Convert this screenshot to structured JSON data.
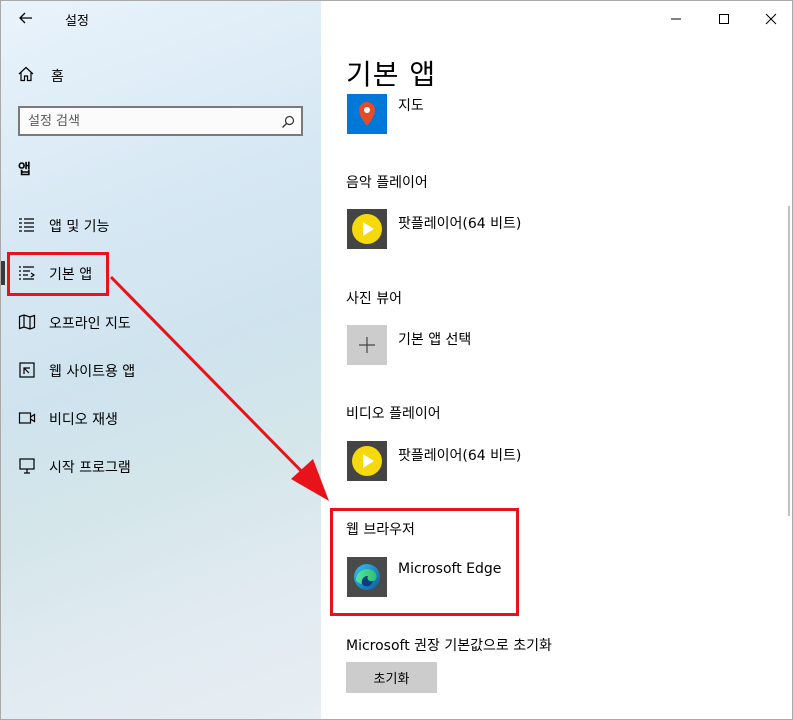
{
  "window": {
    "title": "설정",
    "controls": [
      "minimize-icon",
      "maximize-icon",
      "close-icon"
    ]
  },
  "sidebar": {
    "home_label": "홈",
    "search_placeholder": "설정 검색",
    "section_label": "앱",
    "items": [
      {
        "label": "앱 및 기능",
        "icon": "list-icon",
        "selected": false
      },
      {
        "label": "기본 앱",
        "icon": "default-apps-icon",
        "selected": true
      },
      {
        "label": "오프라인 지도",
        "icon": "map-icon",
        "selected": false
      },
      {
        "label": "웹 사이트용 앱",
        "icon": "website-app-icon",
        "selected": false
      },
      {
        "label": "비디오 재생",
        "icon": "video-icon",
        "selected": false
      },
      {
        "label": "시작 프로그램",
        "icon": "startup-icon",
        "selected": false
      }
    ]
  },
  "main": {
    "title": "기본 앱",
    "map_app_name": "지도",
    "categories": [
      {
        "label": "음악 플레이어",
        "app_name": "팟플레이어(64 비트)",
        "icon": "potplayer-icon"
      },
      {
        "label": "사진 뷰어",
        "app_name": "기본 앱 선택",
        "icon": "plus-icon"
      },
      {
        "label": "비디오 플레이어",
        "app_name": "팟플레이어(64 비트)",
        "icon": "potplayer-icon"
      },
      {
        "label": "웹 브라우저",
        "app_name": "Microsoft Edge",
        "icon": "edge-icon"
      }
    ],
    "reset_label": "Microsoft 권장 기본값으로 초기화",
    "reset_button": "초기화"
  },
  "colors": {
    "annotation_red": "#e8121b",
    "maps_tile": "#0078d7",
    "potplayer_tile": "#444444",
    "potplayer_yellow": "#f5d90a",
    "placeholder_tile": "#cccccc"
  }
}
